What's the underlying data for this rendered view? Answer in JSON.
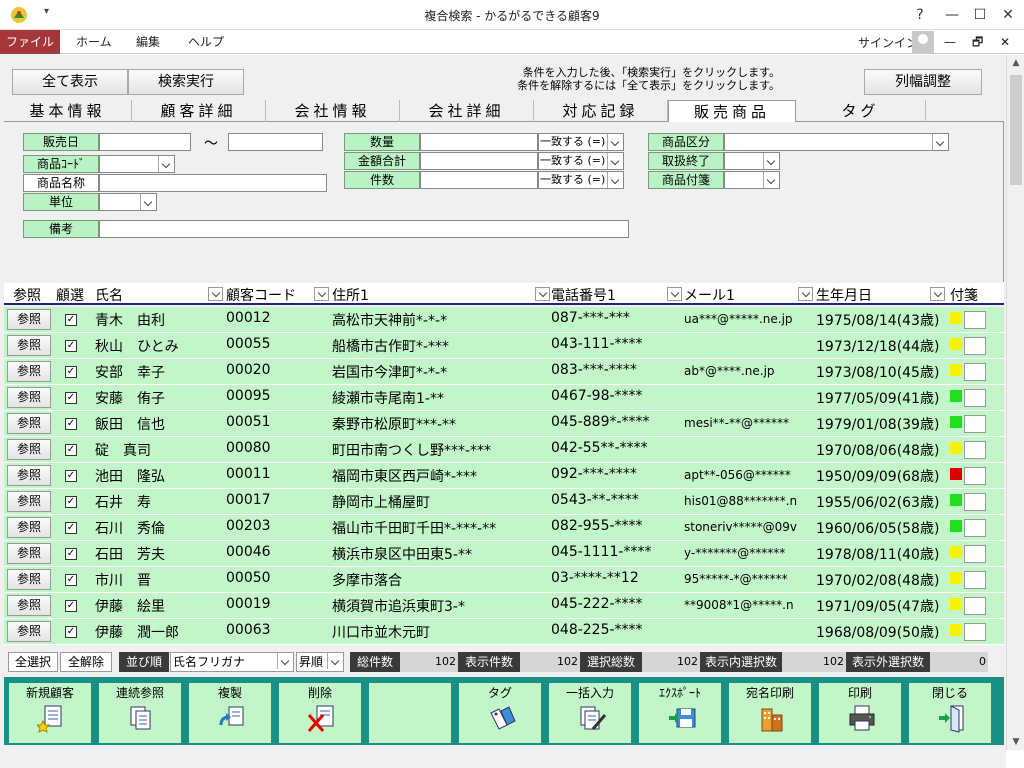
{
  "window": {
    "title": "複合検索 - かるがるできる顧客9",
    "help": "?",
    "minimize": "—",
    "maximize": "☐",
    "close": "✕"
  },
  "menu": {
    "file": "ファイル",
    "home": "ホーム",
    "edit": "編集",
    "help": "ヘルプ",
    "signin": "サインイン",
    "restore": "🗗",
    "close": "✕"
  },
  "top": {
    "show_all": "全て表示",
    "search_exec": "検索実行",
    "hint_line1": "条件を入力した後、「検索実行」をクリックします。",
    "hint_line2": "条件を解除するには「全て表示」をクリックします。",
    "col_adjust": "列幅調整"
  },
  "tabs": [
    "基本情報",
    "顧客詳細",
    "会社情報",
    "会社詳細",
    "対応記録",
    "販売商品",
    "タグ"
  ],
  "filters": {
    "sale_date": "販売日",
    "tilde": "～",
    "product_code": "商品ｺｰﾄﾞ",
    "product_name": "商品名称",
    "unit": "単位",
    "note": "備考",
    "quantity": "数量",
    "amount_total": "金額合計",
    "count": "件数",
    "match_option": "一致する (=)",
    "product_category": "商品区分",
    "handling_end": "取扱終了",
    "product_tag": "商品付箋"
  },
  "grid": {
    "headers": {
      "ref": "参照",
      "select": "顧選",
      "name": "氏名",
      "code": "顧客コード",
      "address": "住所1",
      "phone": "電話番号1",
      "mail": "メール1",
      "birth": "生年月日",
      "tag": "付箋"
    },
    "ref_label": "参照",
    "check_mark": "✓",
    "rows": [
      {
        "name": "青木　由利",
        "code": "00012",
        "address": "高松市天神前*-*-*",
        "phone": "087-***-***",
        "mail": "ua***@*****.ne.jp",
        "birth": "1975/08/14(43歳)",
        "tag": "#f7f300"
      },
      {
        "name": "秋山　ひとみ",
        "code": "00055",
        "address": "船橋市古作町*-***",
        "phone": "043-111-****",
        "mail": "",
        "birth": "1973/12/18(44歳)",
        "tag": "#f7f300"
      },
      {
        "name": "安部　幸子",
        "code": "00020",
        "address": "岩国市今津町*-*-*",
        "phone": "083-***-****",
        "mail": "ab*@****.ne.jp",
        "birth": "1973/08/10(45歳)",
        "tag": "#f7f300"
      },
      {
        "name": "安藤　侑子",
        "code": "00095",
        "address": "綾瀬市寺尾南1-**",
        "phone": "0467-98-****",
        "mail": "",
        "birth": "1977/05/09(41歳)",
        "tag": "#1ee01e"
      },
      {
        "name": "飯田　信也",
        "code": "00051",
        "address": "秦野市松原町***-**",
        "phone": "045-889*-****",
        "mail": "mesi**-**@******",
        "birth": "1979/01/08(39歳)",
        "tag": "#1ee01e"
      },
      {
        "name": "碇　真司",
        "code": "00080",
        "address": "町田市南つくし野***-***",
        "phone": "042-55**-****",
        "mail": "",
        "birth": "1970/08/06(48歳)",
        "tag": "#f7f300"
      },
      {
        "name": "池田　隆弘",
        "code": "00011",
        "address": "福岡市東区西戸崎*-***",
        "phone": "092-***-****",
        "mail": "apt**-056@******",
        "birth": "1950/09/09(68歳)",
        "tag": "#e00000"
      },
      {
        "name": "石井　寿",
        "code": "00017",
        "address": "静岡市上桶屋町",
        "phone": "0543-**-****",
        "mail": "his01@88*******.n",
        "birth": "1955/06/02(63歳)",
        "tag": "#1ee01e"
      },
      {
        "name": "石川　秀倫",
        "code": "00203",
        "address": "福山市千田町千田*-***-**",
        "phone": "082-955-****",
        "mail": "stoneriv*****@09v",
        "birth": "1960/06/05(58歳)",
        "tag": "#1ee01e"
      },
      {
        "name": "石田　芳夫",
        "code": "00046",
        "address": "横浜市泉区中田東5-**",
        "phone": "045-1111-****",
        "mail": "y-*******@******",
        "birth": "1978/08/11(40歳)",
        "tag": "#f7f300"
      },
      {
        "name": "市川　晋",
        "code": "00050",
        "address": "多摩市落合",
        "phone": "03-****-**12",
        "mail": "95*****-*@******",
        "birth": "1970/02/08(48歳)",
        "tag": "#f7f300"
      },
      {
        "name": "伊藤　絵里",
        "code": "00019",
        "address": "横須賀市追浜東町3-*",
        "phone": "045-222-****",
        "mail": "**9008*1@*****.n",
        "birth": "1971/09/05(47歳)",
        "tag": "#f7f300"
      },
      {
        "name": "伊藤　潤一郎",
        "code": "00063",
        "address": "川口市並木元町",
        "phone": "048-225-****",
        "mail": "",
        "birth": "1968/08/09(50歳)",
        "tag": "#f7f300"
      }
    ]
  },
  "status": {
    "select_all": "全選択",
    "deselect_all": "全解除",
    "sort_order": "並び順",
    "sort_field": "氏名フリガナ",
    "sort_dir": "昇順",
    "total_label": "総件数",
    "total_value": "102",
    "shown_label": "表示件数",
    "shown_value": "102",
    "selected_total_label": "選択総数",
    "selected_total_value": "102",
    "in_view_selected_label": "表示内選択数",
    "in_view_selected_value": "102",
    "out_view_selected_label": "表示外選択数",
    "out_view_selected_value": "0"
  },
  "toolbar": {
    "new_customer": "新規顧客",
    "continuous_ref": "連続参照",
    "duplicate": "複製",
    "delete": "削除",
    "tag": "タグ",
    "bulk_input": "一括入力",
    "export": "ｴｸｽﾎﾟｰﾄ",
    "address_print": "宛名印刷",
    "print": "印刷",
    "close": "閉じる"
  }
}
